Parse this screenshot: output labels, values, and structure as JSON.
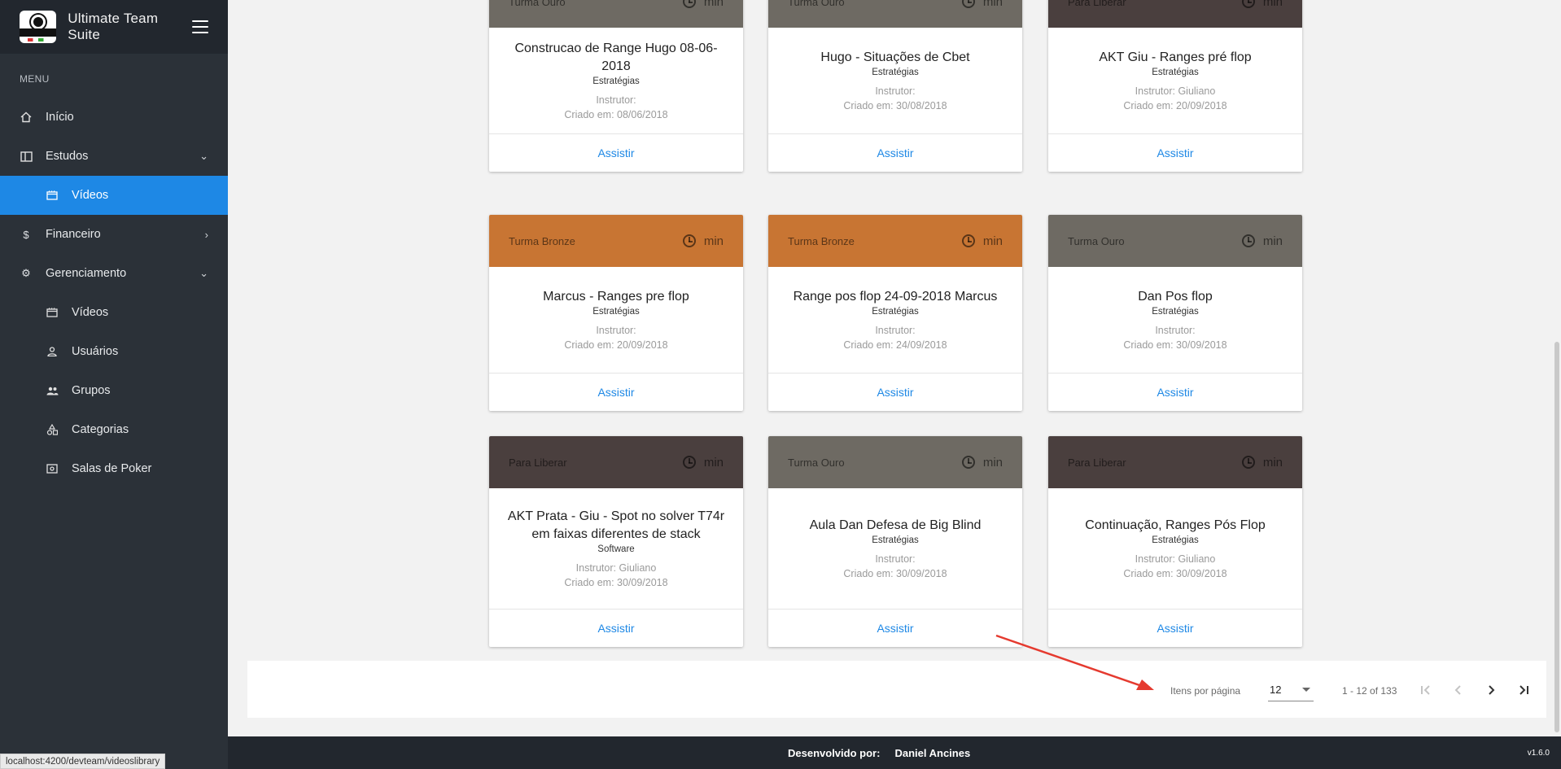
{
  "app": {
    "title": "Ultimate Team Suite",
    "logo_icon": "ultimate-ball-logo",
    "hamburger_icon": "menu-icon"
  },
  "sidebar": {
    "menu_label": "MENU",
    "items": [
      {
        "label": "Início",
        "icon": "home-icon"
      },
      {
        "label": "Estudos",
        "icon": "book-icon",
        "chevron": "˅"
      },
      {
        "label": "Vídeos",
        "icon": "movie-icon",
        "active": true
      },
      {
        "label": "Financeiro",
        "icon": "dollar-icon",
        "chevron": "›"
      },
      {
        "label": "Gerenciamento",
        "icon": "gear-icon",
        "chevron": "˅"
      },
      {
        "label": "Vídeos",
        "icon": "movie-icon"
      },
      {
        "label": "Usuários",
        "icon": "person-icon"
      },
      {
        "label": "Grupos",
        "icon": "group-icon"
      },
      {
        "label": "Categorias",
        "icon": "shapes-icon"
      },
      {
        "label": "Salas de Poker",
        "icon": "poker-room-icon"
      }
    ]
  },
  "cards": [
    {
      "group": "Turma Ouro",
      "duration": "min",
      "title": "Construcao de Range Hugo 08-06-2018",
      "category": "Estratégias",
      "instructor": "Instrutor:",
      "created": "Criado em: 08/06/2018",
      "action": "Assistir",
      "color": "#6e6a63"
    },
    {
      "group": "Turma Ouro",
      "duration": "min",
      "title": "Hugo - Situações de Cbet",
      "category": "Estratégias",
      "instructor": "Instrutor:",
      "created": "Criado em: 30/08/2018",
      "action": "Assistir",
      "color": "#6e6a63"
    },
    {
      "group": "Para Liberar",
      "duration": "min",
      "title": "AKT Giu - Ranges pré flop",
      "category": "Estratégias",
      "instructor": "Instrutor: Giuliano",
      "created": "Criado em: 20/09/2018",
      "action": "Assistir",
      "color": "#4a3f3e"
    },
    {
      "group": "Turma Bronze",
      "duration": "min",
      "title": "Marcus - Ranges pre flop",
      "category": "Estratégias",
      "instructor": "Instrutor:",
      "created": "Criado em: 20/09/2018",
      "action": "Assistir",
      "color": "#c87533"
    },
    {
      "group": "Turma Bronze",
      "duration": "min",
      "title": "Range pos flop 24-09-2018 Marcus",
      "category": "Estratégias",
      "instructor": "Instrutor:",
      "created": "Criado em: 24/09/2018",
      "action": "Assistir",
      "color": "#c87533"
    },
    {
      "group": "Turma Ouro",
      "duration": "min",
      "title": "Dan Pos flop",
      "category": "Estratégias",
      "instructor": "Instrutor:",
      "created": "Criado em: 30/09/2018",
      "action": "Assistir",
      "color": "#6e6a63"
    },
    {
      "group": "Para Liberar",
      "duration": "min",
      "title": "AKT Prata - Giu - Spot no solver T74r em faixas diferentes de stack",
      "category": "Software",
      "instructor": "Instrutor: Giuliano",
      "created": "Criado em: 30/09/2018",
      "action": "Assistir",
      "color": "#4a3f3e"
    },
    {
      "group": "Turma Ouro",
      "duration": "min",
      "title": "Aula Dan Defesa de Big Blind",
      "category": "Estratégias",
      "instructor": "Instrutor:",
      "created": "Criado em: 30/09/2018",
      "action": "Assistir",
      "color": "#6e6a63"
    },
    {
      "group": "Para Liberar",
      "duration": "min",
      "title": "Continuação, Ranges Pós Flop",
      "category": "Estratégias",
      "instructor": "Instrutor: Giuliano",
      "created": "Criado em: 30/09/2018",
      "action": "Assistir",
      "color": "#4a3f3e"
    }
  ],
  "paginator": {
    "label": "Itens por página",
    "page_size": "12",
    "range": "1 - 12 of 133",
    "first_icon": "first-page-icon",
    "prev_icon": "chevron-left-icon",
    "next_icon": "chevron-right-icon",
    "last_icon": "last-page-icon"
  },
  "annotation": {
    "color": "#e53a2f"
  },
  "footer": {
    "developed_by": "Desenvolvido por:",
    "author": "Daniel Ancines",
    "version": "v1.6.0"
  },
  "status_bar": {
    "url": "localhost:4200/devteam/videoslibrary"
  }
}
